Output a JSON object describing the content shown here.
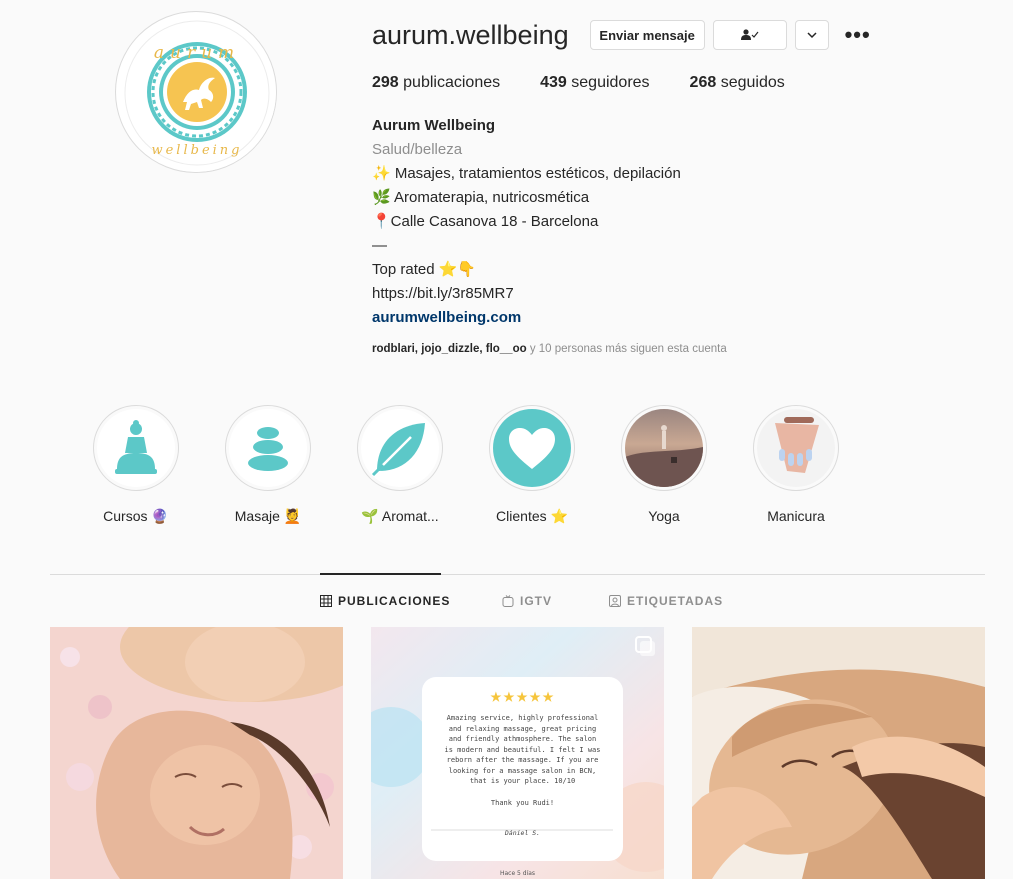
{
  "profile": {
    "username": "aurum.wellbeing",
    "avatar_text_top": "aurum",
    "avatar_text_bottom": "wellbeing"
  },
  "actions": {
    "message_label": "Enviar mensaje",
    "following_icon": "person-check-icon",
    "chevron_icon": "chevron-down-icon",
    "more_icon": "more-dots-icon",
    "more_glyph": "•••"
  },
  "stats": [
    {
      "count": "298",
      "label": "publicaciones"
    },
    {
      "count": "439",
      "label": "seguidores"
    },
    {
      "count": "268",
      "label": "seguidos"
    }
  ],
  "bio": {
    "name": "Aurum Wellbeing",
    "category": "Salud/belleza",
    "lines": [
      "✨ Masajes, tratamientos estéticos, depilación",
      "🌿 Aromaterapia, nutricosmética",
      "📍Calle Casanova 18 - Barcelona",
      "—",
      "Top rated ⭐👇",
      "https://bit.ly/3r85MR7"
    ],
    "website": "aurumwellbeing.com"
  },
  "followed_by": {
    "users": "rodblari, jojo_dizzle, flo__oo",
    "rest": " y 10 personas más siguen esta cuenta"
  },
  "highlights": [
    {
      "label": "Cursos 🔮",
      "icon": "buddha-icon"
    },
    {
      "label": "Masaje 💆",
      "icon": "stacked-stones-icon"
    },
    {
      "label": "🌱 Aromat...",
      "icon": "leaf-icon"
    },
    {
      "label": "Clientes ⭐",
      "icon": "heart-icon"
    },
    {
      "label": "Yoga",
      "icon": "yoga-photo"
    },
    {
      "label": "Manicura",
      "icon": "manicure-photo"
    }
  ],
  "tabs": [
    {
      "label": "PUBLICACIONES",
      "icon": "grid-icon",
      "active": true
    },
    {
      "label": "IGTV",
      "icon": "igtv-icon",
      "active": false
    },
    {
      "label": "ETIQUETADAS",
      "icon": "tagged-icon",
      "active": false
    }
  ],
  "posts": [
    {
      "type": "photo",
      "subject": "couple-massage"
    },
    {
      "type": "carousel",
      "review_stars": "★★★★★",
      "review_lines": [
        "Amazing service, highly professional",
        "and relaxing massage, great pricing",
        "and friendly athmosphere. The salon",
        "is modern and beautiful. I felt I was",
        "reborn after the massage. If you are",
        "looking for a massage salon in BCN,",
        "that is your place. 10/10"
      ],
      "review_thanks": "Thank you Rudi!",
      "review_author": "Dániel S.",
      "review_time": "Hace 5 días"
    },
    {
      "type": "photo",
      "subject": "face-massage"
    }
  ],
  "colors": {
    "teal": "#5cc8c8",
    "gold": "#e8b84a",
    "link": "#00376b",
    "muted": "#8e8e8e"
  }
}
